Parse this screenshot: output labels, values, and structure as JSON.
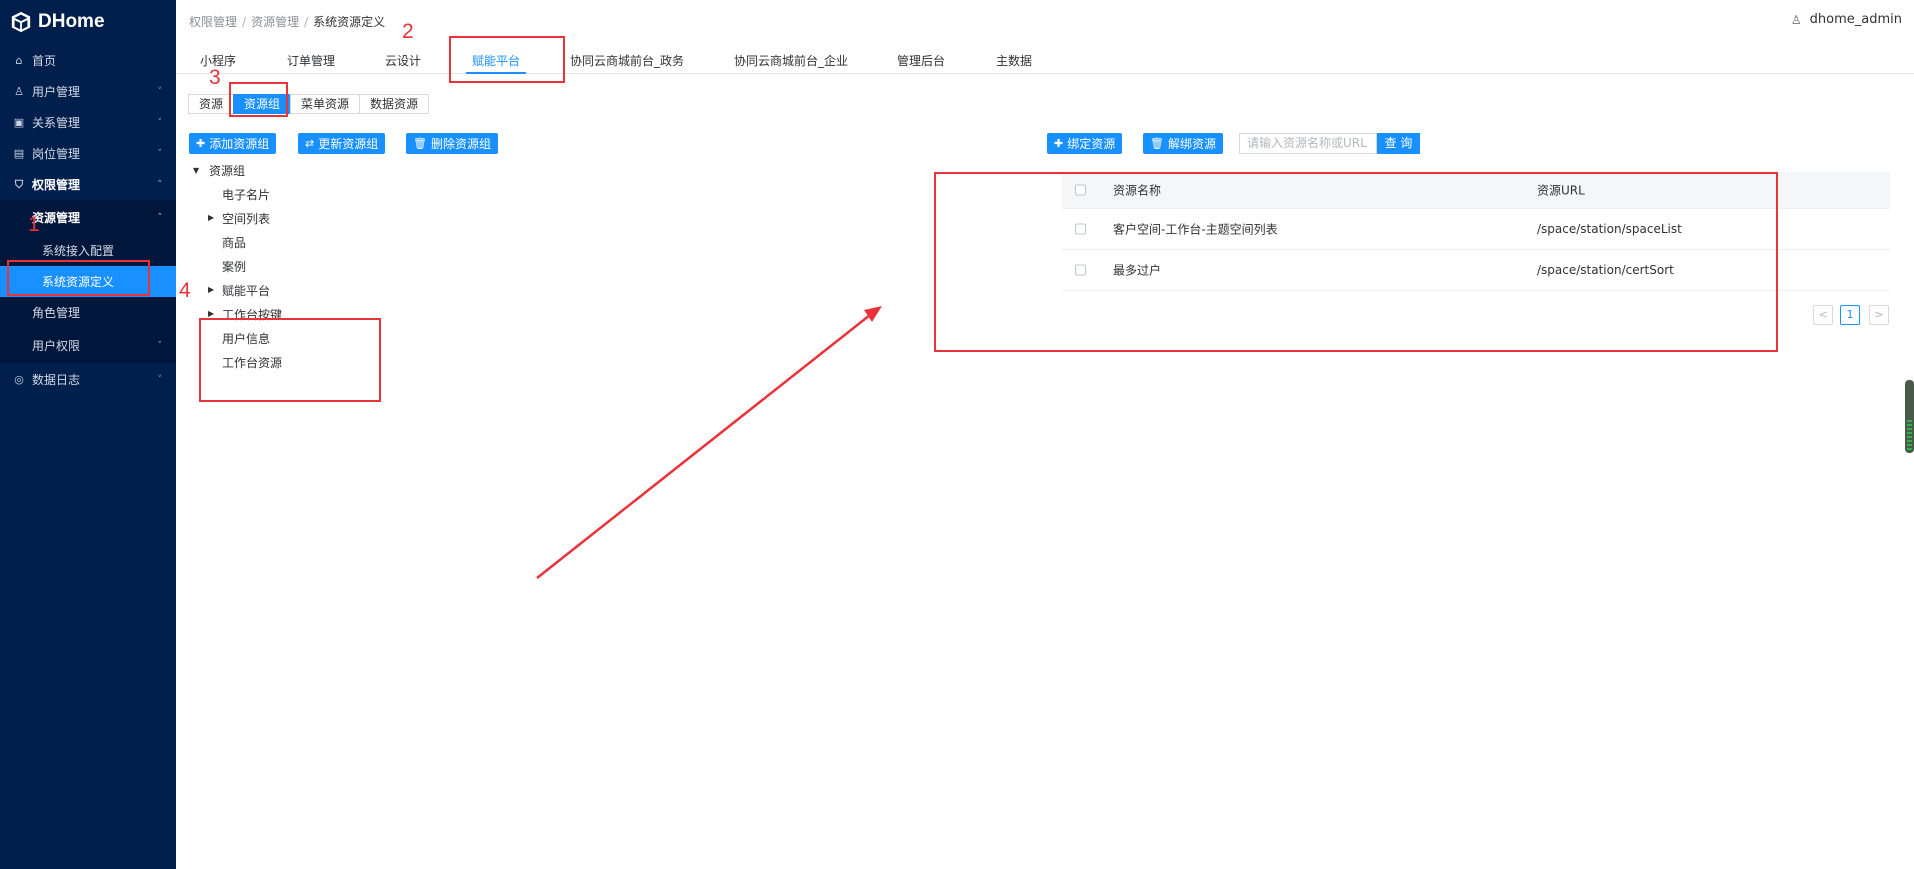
{
  "app": {
    "name": "DHome"
  },
  "sidebar": {
    "items": [
      {
        "label": "首页",
        "icon": "home-icon"
      },
      {
        "label": "用户管理",
        "icon": "user-icon"
      },
      {
        "label": "关系管理",
        "icon": "relation-icon"
      },
      {
        "label": "岗位管理",
        "icon": "post-icon"
      },
      {
        "label": "权限管理",
        "icon": "shield-icon"
      }
    ],
    "permission_sub": [
      {
        "label": "资源管理"
      },
      {
        "label": "系统接入配置"
      },
      {
        "label": "系统资源定义"
      },
      {
        "label": "角色管理"
      },
      {
        "label": "用户权限"
      }
    ],
    "data_log": {
      "label": "数据日志",
      "icon": "log-icon"
    }
  },
  "header": {
    "breadcrumb": [
      "权限管理",
      "资源管理",
      "系统资源定义"
    ],
    "user": "dhome_admin"
  },
  "tabs": [
    "小程序",
    "订单管理",
    "云设计",
    "赋能平台",
    "协同云商城前台_政务",
    "协同云商城前台_企业",
    "管理后台",
    "主数据"
  ],
  "subtabs": [
    "资源",
    "资源组",
    "菜单资源",
    "数据资源"
  ],
  "toolbar": {
    "add": "添加资源组",
    "update": "更新资源组",
    "delete": "删除资源组",
    "bind": "绑定资源",
    "unbind": "解绑资源",
    "search_placeholder": "请输入资源名称或URL",
    "search": "查 询"
  },
  "tree": {
    "root": "资源组",
    "children": [
      "电子名片",
      "空间列表",
      "商品",
      "案例",
      "赋能平台",
      "工作台按键",
      "用户信息",
      "工作台资源"
    ]
  },
  "table": {
    "columns": [
      "资源名称",
      "资源URL"
    ],
    "rows": [
      {
        "name": "客户空间-工作台-主题空间列表",
        "url": "/space/station/spaceList"
      },
      {
        "name": "最多过户",
        "url": "/space/station/certSort"
      }
    ],
    "page": "1"
  },
  "annotations": [
    "1",
    "2",
    "3",
    "4"
  ],
  "colors": {
    "sidebar": "#001f4d",
    "accent": "#1890ff",
    "annotation": "#e8333a"
  }
}
